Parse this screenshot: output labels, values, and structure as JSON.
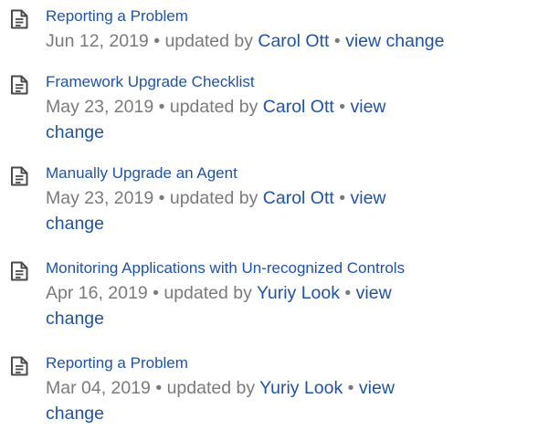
{
  "entries": [
    {
      "title": "Reporting a Problem",
      "date": "Jun 12, 2019",
      "updated_by": "updated by",
      "author": "Carol Ott",
      "bullet": "•",
      "view_change_1": "view change",
      "view_change_2": ""
    },
    {
      "title": "Framework Upgrade Checklist",
      "date": "May 23, 2019",
      "updated_by": "updated by",
      "author": "Carol Ott",
      "bullet": "•",
      "view_change_1": "view",
      "view_change_2": "change"
    },
    {
      "title": "Manually Upgrade an Agent",
      "date": "May 23, 2019",
      "updated_by": "updated by",
      "author": "Carol Ott",
      "bullet": "•",
      "view_change_1": "view",
      "view_change_2": "change"
    },
    {
      "title": "Monitoring Applications with Un-recognized Controls",
      "date": "Apr 16, 2019",
      "updated_by": "updated by",
      "author": "Yuriy Look",
      "bullet": "•",
      "view_change_1": "view",
      "view_change_2": "change"
    },
    {
      "title": "Reporting a Problem",
      "date": "Mar 04, 2019",
      "updated_by": "updated by",
      "author": "Yuriy Look",
      "bullet": "•",
      "view_change_1": "view",
      "view_change_2": "change"
    }
  ],
  "icons": {
    "page": "document-page-icon"
  },
  "colors": {
    "link": "#1f53a6",
    "meta_text": "#7a7a7a",
    "icon_stroke": "#4a4a4a"
  }
}
